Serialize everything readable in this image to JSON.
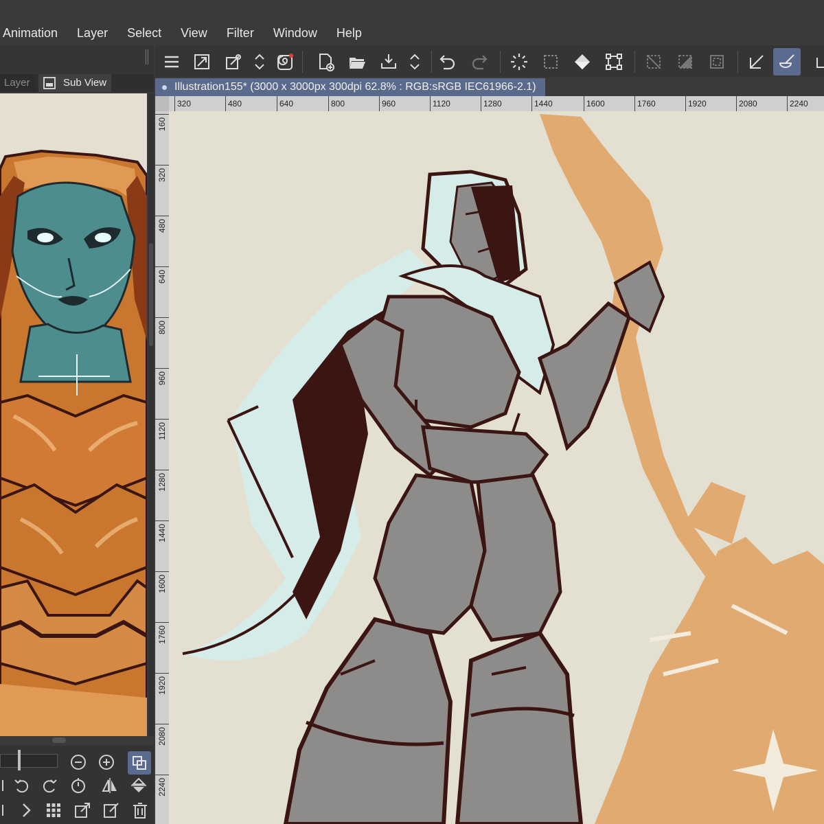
{
  "menu": {
    "items": [
      "Animation",
      "Layer",
      "Select",
      "View",
      "Filter",
      "Window",
      "Help"
    ]
  },
  "sub_panel": {
    "tab_layer": "Layer",
    "tab_subview": "Sub View"
  },
  "canvas": {
    "title": "Illustration155* (3000 x 3000px 300dpi 62.8% : RGB:sRGB IEC61966-2.1)"
  },
  "ruler": {
    "top": [
      "320",
      "480",
      "640",
      "800",
      "960",
      "1120",
      "1280",
      "1440",
      "1600",
      "1760",
      "1920",
      "2080",
      "2240"
    ],
    "left": [
      "160",
      "320",
      "480",
      "640",
      "800",
      "960",
      "1120",
      "1280",
      "1440",
      "1600",
      "1760",
      "1920",
      "2080",
      "2240"
    ]
  },
  "icons": {
    "toolbar": [
      "menu-icon",
      "fit-icon",
      "eyedropper-icon",
      "updown-icon",
      "spiral-icon",
      "new-file-icon",
      "open-folder-icon",
      "save-icon",
      "updown-icon",
      "undo-icon",
      "redo-icon",
      "loading-icon",
      "selection-icon",
      "fill-icon",
      "transform-icon",
      "deselect-icon",
      "invert-selection-icon",
      "selection-border-icon",
      "pen-icon",
      "brush-icon"
    ],
    "subview": [
      "zoom-out-icon",
      "zoom-in-icon",
      "eyedropper-toggle-icon",
      "rotate-left-icon",
      "rotate-right-icon",
      "reset-rotation-icon",
      "flip-horizontal-icon",
      "flip-vertical-icon",
      "next-icon",
      "grid-icon",
      "import-icon",
      "edit-icon",
      "trash-icon"
    ]
  },
  "colors": {
    "accent": "#5b6a8f",
    "canvas_bg": "#e4e0d1",
    "line_art": "#3a1512",
    "armor_fill": "#8e8c8a",
    "cloak_fill": "#d5ece8",
    "orange_bg": "#e1aa70",
    "ref_orange": "#c8742f",
    "ref_skin": "#4e8d8e"
  }
}
